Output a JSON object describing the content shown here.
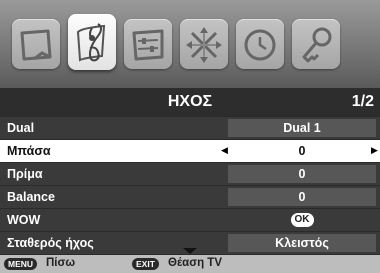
{
  "tabs": [
    {
      "name": "picture-icon"
    },
    {
      "name": "sound-icon",
      "active": true
    },
    {
      "name": "setup-icon"
    },
    {
      "name": "function-icon"
    },
    {
      "name": "timer-icon"
    },
    {
      "name": "lock-icon"
    }
  ],
  "header": {
    "title": "ΗΧΟΣ",
    "page": "1/2"
  },
  "rows": [
    {
      "label": "Dual",
      "value": "Dual 1"
    },
    {
      "label": "Μπάσα",
      "value": "0",
      "selected": true,
      "arrows": true
    },
    {
      "label": "Πρίμα",
      "value": "0"
    },
    {
      "label": "Balance",
      "value": "0"
    },
    {
      "label": "WOW",
      "value": "OK",
      "button": true
    },
    {
      "label": "Σταθερός ήχος",
      "value": "Κλειστός"
    }
  ],
  "footer": {
    "menu_key": "MENU",
    "menu_label": "Πίσω",
    "exit_key": "EXIT",
    "exit_label": "Θέαση TV"
  },
  "colors": {
    "selected_row": "#ffffff",
    "row_bg": "#3a3a3a",
    "value_bg": "#575757",
    "footer_bg": "#bdbdbd"
  }
}
